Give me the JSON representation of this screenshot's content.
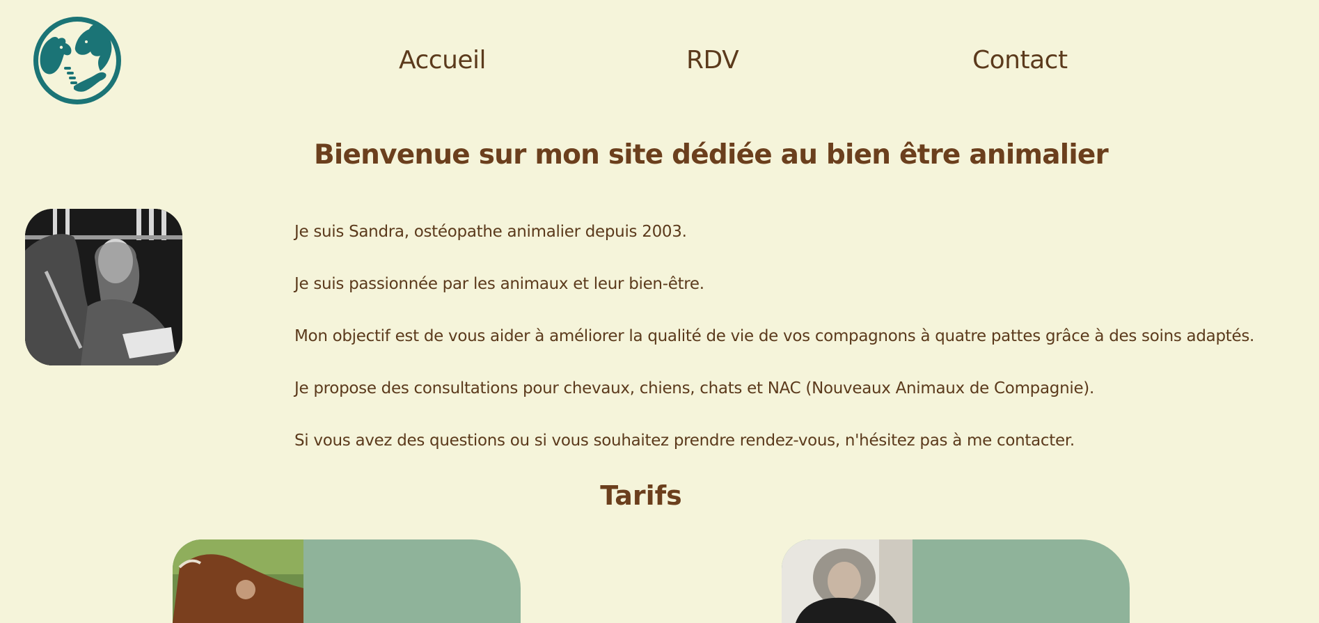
{
  "nav": {
    "items": [
      {
        "label": "Accueil"
      },
      {
        "label": "RDV"
      },
      {
        "label": "Contact"
      }
    ]
  },
  "main": {
    "title": "Bienvenue sur mon site dédiée au bien être animalier",
    "paragraphs": [
      "Je suis Sandra, ostéopathe animalier depuis 2003.",
      "Je suis passionnée par les animaux et leur bien-être.",
      "Mon objectif est de vous aider à améliorer la qualité de vie de vos compagnons à quatre pattes grâce à des soins adaptés.",
      "Je propose des consultations pour chevaux, chiens, chats et NAC (Nouveaux Animaux de Compagnie).",
      "Si vous avez des questions ou si vous souhaitez prendre rendez-vous, n'hésitez pas à me contacter."
    ]
  },
  "tarifs": {
    "title": "Tarifs"
  },
  "colors": {
    "background": "#f5f4da",
    "text": "#5b3a1c",
    "heading": "#6b3f1d",
    "logo_teal": "#1b7476",
    "card_green": "#8fb39a"
  },
  "icons": {
    "logo": "dog-horse-hand-logo-icon"
  }
}
